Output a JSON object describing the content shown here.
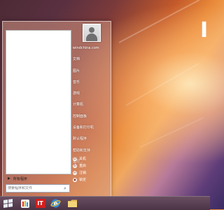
{
  "desktop": {
    "brand_text": "I"
  },
  "start_menu": {
    "all_programs_label": "所有程序",
    "search_placeholder": "搜索程序和文件",
    "user_label": "windchina.com",
    "right_items": [
      "文档",
      "图片",
      "音乐",
      "游戏",
      "计算机",
      "控制面板",
      "设备和打印机",
      "默认程序",
      "帮助和支持",
      "运行..."
    ],
    "power_items": [
      "关机",
      "重启",
      "注销",
      "锁定"
    ]
  },
  "taskbar": {
    "buttons": [
      "start",
      "media-player",
      "it-app",
      "internet-explorer",
      "file-explorer"
    ],
    "it_label": "IT"
  },
  "colors": {
    "taskbar": "#5a4054",
    "it_red": "#d0201f"
  }
}
